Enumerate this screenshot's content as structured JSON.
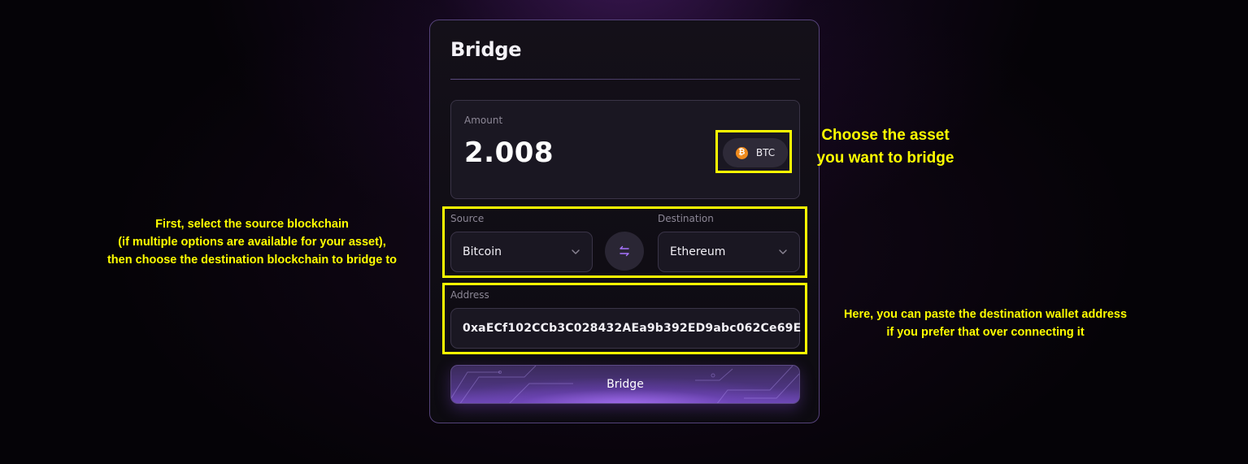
{
  "card": {
    "title": "Bridge",
    "amount": {
      "label": "Amount",
      "value": "2.008"
    },
    "asset": {
      "symbol": "BTC",
      "icon": "bitcoin-icon",
      "icon_glyph": "₿",
      "icon_color": "#f08b1d"
    },
    "source": {
      "label": "Source",
      "value": "Bitcoin"
    },
    "destination": {
      "label": "Destination",
      "value": "Ethereum"
    },
    "swap_icon": "swap-arrows-icon",
    "address": {
      "label": "Address",
      "value": "0xaECf102CCb3C028432AEa9b392ED9abc062Ce69E"
    },
    "submit_label": "Bridge"
  },
  "annotations": {
    "asset": {
      "line1": "Choose the asset",
      "line2": "you want to bridge"
    },
    "chains": {
      "line1": "First, select the source blockchain",
      "line2": "(if multiple options are available for your asset),",
      "line3": "then choose the destination blockchain to bridge to"
    },
    "address": {
      "line1": "Here, you can paste the destination wallet address",
      "line2": "if you prefer that over connecting it"
    }
  },
  "colors": {
    "accent": "#a874ff",
    "annotation": "#ffff00",
    "card_border": "#55437a",
    "background": "#050307"
  }
}
